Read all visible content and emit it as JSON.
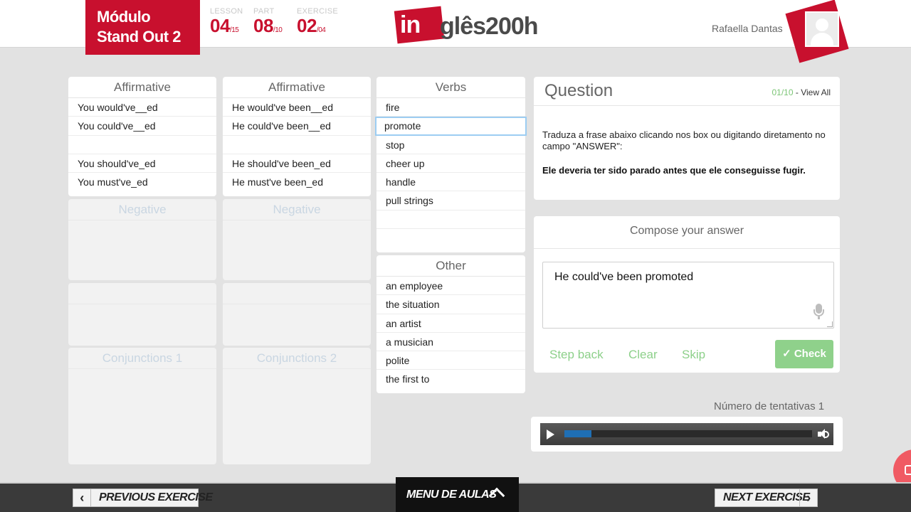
{
  "header": {
    "module_line1": "Módulo",
    "module_line2": "Stand Out 2",
    "lesson": {
      "label": "LESSON",
      "value": "04",
      "total": "/15"
    },
    "part": {
      "label": "PART",
      "value": "08",
      "total": "/10"
    },
    "exercise": {
      "label": "EXERCISE",
      "value": "02",
      "total": "/04"
    },
    "logo_in": "in",
    "logo_rest": "glês200h",
    "user_name": "Rafaella Dantas"
  },
  "columns": {
    "affirmative1": {
      "title": "Affirmative",
      "items": [
        "You would've__ed",
        "You could've__ed",
        "",
        "You should've_ed",
        "You must've_ed"
      ]
    },
    "affirmative2": {
      "title": "Affirmative",
      "items": [
        "He would've been__ed",
        "He could've been__ed",
        "",
        "He should've been_ed",
        "He must've been_ed"
      ]
    },
    "negative1": {
      "title": "Negative"
    },
    "negative2": {
      "title": "Negative"
    },
    "conjunctions1": {
      "title": "Conjunctions 1"
    },
    "conjunctions2": {
      "title": "Conjunctions 2"
    },
    "verbs": {
      "title": "Verbs",
      "items": [
        "fire",
        "promote",
        "stop",
        "cheer up",
        "handle",
        "pull strings",
        ""
      ],
      "selected_index": 1
    },
    "other": {
      "title": "Other",
      "items": [
        "an employee",
        "the situation",
        "an artist",
        "a musician",
        "polite",
        "the first to"
      ]
    }
  },
  "question": {
    "title": "Question",
    "counter": "01/10",
    "view_all": "- View All",
    "instruction": "Traduza a frase abaixo clicando nos box ou digitando diretamento no campo \"ANSWER\":",
    "sentence": "Ele deveria ter sido parado antes que ele conseguisse fugir."
  },
  "compose": {
    "title": "Compose your answer",
    "answer": "He could've been promoted",
    "step_back": "Step back",
    "clear": "Clear",
    "skip": "Skip",
    "check": "✓ Check"
  },
  "attempts": "Número de tentativas 1",
  "player": {
    "progress": 0.11
  },
  "footer": {
    "previous": "Previous Exercise",
    "menu": "Menu de Aulas",
    "next": "Next Exercise"
  },
  "colors": {
    "brand_red": "#c8102e",
    "accent_green": "#8fd18b",
    "progress_blue": "#1f6fb5"
  },
  "icons": [
    "user-avatar-icon",
    "microphone-icon",
    "play-icon",
    "volume-icon",
    "chat-icon",
    "chevron-left-icon",
    "chevron-right-icon",
    "chevron-up-icon"
  ]
}
